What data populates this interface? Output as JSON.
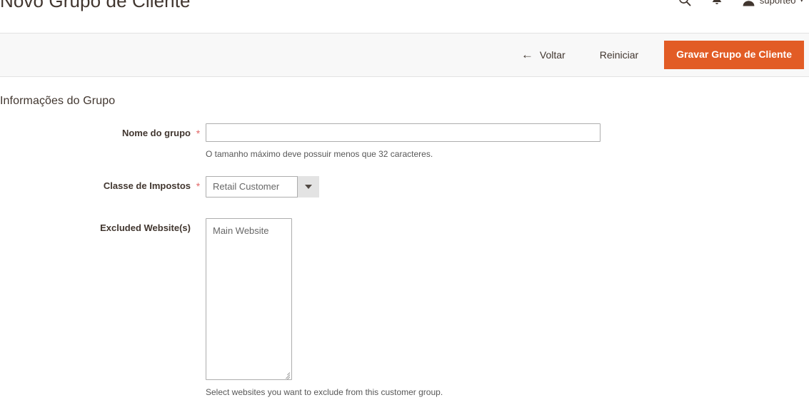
{
  "header": {
    "title": "Novo Grupo de Cliente",
    "icons": {
      "search": "search-icon",
      "notifications": "bell-icon",
      "avatar": "user-avatar-icon"
    },
    "user_name": "suporteo",
    "user_caret": "▾"
  },
  "page_actions": {
    "back_arrow": "←",
    "back_label": "Voltar",
    "reset_label": "Reiniciar",
    "save_label": "Gravar Grupo de Cliente",
    "primary_color": "#e25c25"
  },
  "section": {
    "title": "Informações do Grupo"
  },
  "fields": {
    "group_name": {
      "label": "Nome do grupo",
      "required_mark": "*",
      "value": "",
      "placeholder": "",
      "note": "O tamanho máximo deve possuir menos que 32 caracteres."
    },
    "tax_class": {
      "label": "Classe de Impostos",
      "required_mark": "*",
      "selected": "Retail Customer",
      "options": [
        "Retail Customer"
      ]
    },
    "excluded_websites": {
      "label": "Excluded Website(s)",
      "required_mark": "",
      "options": [
        "Main Website"
      ],
      "note": "Select websites you want to exclude from this customer group."
    }
  }
}
